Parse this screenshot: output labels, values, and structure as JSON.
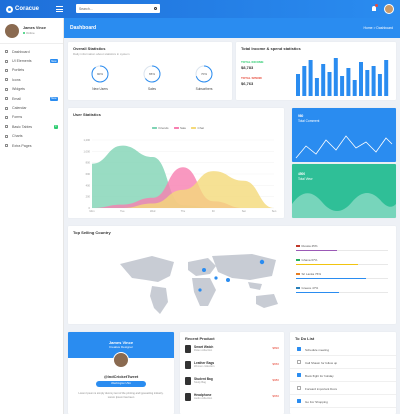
{
  "brand": {
    "name": "Coracue"
  },
  "topbar": {
    "search_placeholder": "Search..."
  },
  "user": {
    "name": "James Vince",
    "status": "Online"
  },
  "menu": [
    {
      "label": "Dashboard",
      "badge": ""
    },
    {
      "label": "UI Elements",
      "badge": "New"
    },
    {
      "label": "Portlets",
      "badge": ""
    },
    {
      "label": "Icons",
      "badge": ""
    },
    {
      "label": "Widgets",
      "badge": ""
    },
    {
      "label": "Email",
      "badge": "New"
    },
    {
      "label": "Calendar",
      "badge": ""
    },
    {
      "label": "Forms",
      "badge": ""
    },
    {
      "label": "Basic Tables",
      "badge": "3"
    },
    {
      "label": "Charts",
      "badge": ""
    },
    {
      "label": "Extra Pages",
      "badge": ""
    }
  ],
  "banner": {
    "title": "Dashboard",
    "breadcrumb": "Home > Dashboard"
  },
  "overall": {
    "title": "Overall Statistics",
    "subtitle": "Daily information about statistics in system",
    "rings": [
      {
        "label": "New Users",
        "value": "90%",
        "color": "#2a8cf0",
        "fraction": 0.9
      },
      {
        "label": "Sales",
        "value": "65%",
        "color": "#2a8cf0",
        "fraction": 0.65
      },
      {
        "label": "Subscribers",
        "value": "70%",
        "color": "#2a8cf0",
        "fraction": 0.7
      }
    ]
  },
  "income": {
    "title": "Total Income & spend statistics",
    "income_label": "TOTAL INCOME",
    "income_value": "$8,783",
    "spend_label": "TOTAL SPEND",
    "spend_value": "$6,763",
    "income_color": "#2ecc71",
    "spend_color": "#e74c3c",
    "bars": [
      0.55,
      0.75,
      0.9,
      0.45,
      0.8,
      0.6,
      0.95,
      0.5,
      0.7,
      0.4,
      0.85,
      0.65,
      0.75,
      0.55,
      0.9
    ]
  },
  "user_stats": {
    "title": "User Statistics",
    "chart_data": {
      "type": "area",
      "categories": [
        "Mon",
        "Tue",
        "Wed",
        "Thu",
        "Fri",
        "Sat",
        "Sun"
      ],
      "ylim": [
        0,
        1200
      ],
      "yticks": [
        "0",
        "200",
        "400",
        "600",
        "800",
        "1,000",
        "1,200"
      ],
      "series": [
        {
          "name": "Friends",
          "color": "#7fd3b4",
          "values": [
            780,
            1100,
            900,
            50,
            0,
            0,
            0
          ]
        },
        {
          "name": "Sale",
          "color": "#f77eb0",
          "values": [
            0,
            60,
            180,
            720,
            120,
            0,
            0
          ]
        },
        {
          "name": "Chat",
          "color": "#f4d979",
          "values": [
            0,
            0,
            80,
            320,
            650,
            480,
            0
          ]
        }
      ]
    }
  },
  "mini1": {
    "title": "980",
    "subtitle": "Total Comment",
    "color": "#2a8cf0"
  },
  "mini2": {
    "title": "4500",
    "subtitle": "Total View",
    "color": "#2fbf97"
  },
  "top_country": {
    "title": "Top Selling Country",
    "countries": [
      {
        "name": "Russia 45%",
        "pct": 0.45,
        "color": "#9b59b6",
        "flag": "#c0392b"
      },
      {
        "name": "Ghana 67%",
        "pct": 0.67,
        "color": "#f1c40f",
        "flag": "#27ae60"
      },
      {
        "name": "Sri Lanka 76%",
        "pct": 0.76,
        "color": "#2a8cf0",
        "flag": "#e67e22"
      },
      {
        "name": "Greece 47%",
        "pct": 0.47,
        "color": "#2a8cf0",
        "flag": "#2980b9"
      }
    ]
  },
  "profile": {
    "name": "James Vince",
    "role": "Creative Designer",
    "handle": "@IndCricketTweet",
    "location": "Washington USA",
    "bio": "Lorem Ipsum is simply dummy text of the printing and typesetting industry. Lorem Ipsum has been"
  },
  "recent_product": {
    "title": "Recent Product",
    "items": [
      {
        "name": "Smart Watch",
        "desc": "Rolex collection",
        "price": "$890"
      },
      {
        "name": "Leather Bags",
        "desc": "Women collection",
        "price": "$650"
      },
      {
        "name": "Student Bag",
        "desc": "Study Bag",
        "price": "$980"
      },
      {
        "name": "Headphone",
        "desc": "Audio collection",
        "price": "$650"
      }
    ]
  },
  "todo": {
    "title": "To Do List",
    "items": [
      {
        "text": "Schedule meeting",
        "done": true
      },
      {
        "text": "Call Shawn for follow up",
        "done": false
      },
      {
        "text": "Book flight for holiday",
        "done": true
      },
      {
        "text": "Forward important Docs",
        "done": false
      },
      {
        "text": "Go For Shopping",
        "done": true
      }
    ]
  }
}
